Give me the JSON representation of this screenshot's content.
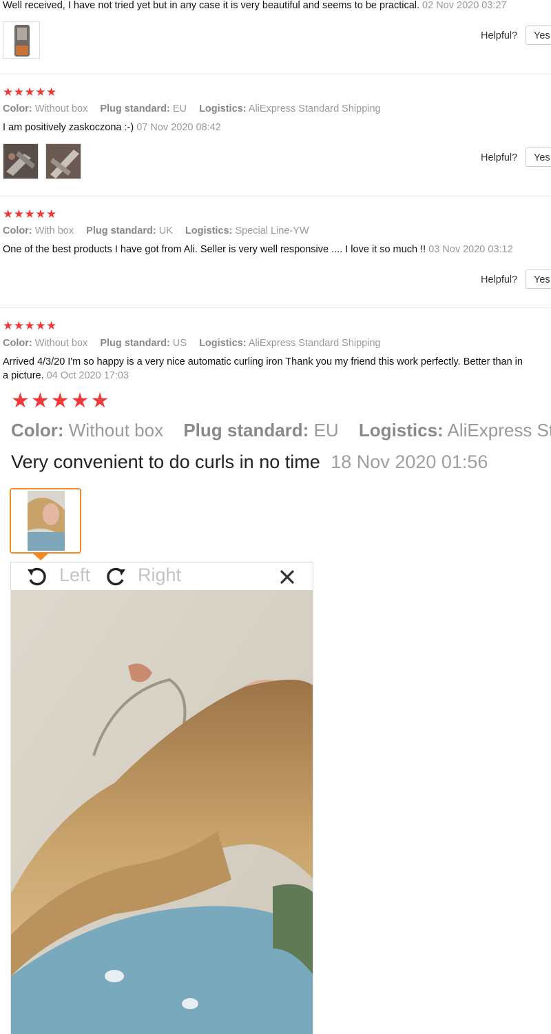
{
  "reviews": [
    {
      "text": "Well received, I have not tried yet but in any case it is very beautiful and seems to be practical.",
      "date": "02 Nov 2020 03:27",
      "helpful_label": "Helpful?",
      "yes_label": "Yes"
    },
    {
      "stars": "★★★★★",
      "color_label": "Color:",
      "color_value": "Without box",
      "plug_label": "Plug standard:",
      "plug_value": "EU",
      "logistics_label": "Logistics:",
      "logistics_value": "AliExpress Standard Shipping",
      "text": "I am positively zaskoczona :-)",
      "date": "07 Nov 2020 08:42",
      "helpful_label": "Helpful?",
      "yes_label": "Yes"
    },
    {
      "stars": "★★★★★",
      "color_label": "Color:",
      "color_value": "With box",
      "plug_label": "Plug standard:",
      "plug_value": "UK",
      "logistics_label": "Logistics:",
      "logistics_value": "Special Line-YW",
      "text": "One of the best products I have got from Ali. Seller is very well responsive .... I love it so much !!",
      "date": "03 Nov 2020 03:12",
      "helpful_label": "Helpful?",
      "yes_label": "Yes"
    },
    {
      "stars": "★★★★★",
      "color_label": "Color:",
      "color_value": "Without box",
      "plug_label": "Plug standard:",
      "plug_value": "US",
      "logistics_label": "Logistics:",
      "logistics_value": "AliExpress Standard Shipping",
      "text_line1": "Arrived 4/3/20 I'm so happy is a very nice automatic curling iron Thank you my friend this work perfectly. Better than in",
      "text_line2": "a picture.",
      "date": "04 Oct 2020 17:03"
    }
  ],
  "zoomed_review": {
    "stars": "★★★★★",
    "color_label": "Color:",
    "color_value": "Without box",
    "plug_label": "Plug standard:",
    "plug_value": "EU",
    "logistics_label": "Logistics:",
    "logistics_value": "AliExpress St",
    "text": "Very convenient to do curls in no time",
    "date": "18 Nov 2020 01:56"
  },
  "viewer": {
    "rotate_left_label": "Left",
    "rotate_right_label": "Right",
    "close_icon": "close-icon"
  },
  "colors": {
    "star": "#ef3a3a",
    "selected_thumb_border": "#f08a24",
    "muted_text": "#999999"
  }
}
